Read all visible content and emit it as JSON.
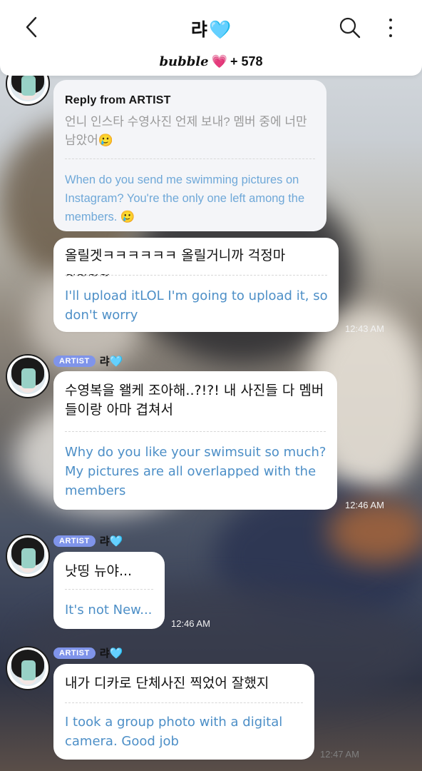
{
  "header": {
    "title": "랴",
    "title_heart": "🩵",
    "brand": "bubble",
    "brand_heart": "💗",
    "count": "+ 578"
  },
  "reply": {
    "heading": "Reply from ARTIST",
    "korean": "언니 인스타 수영사진 언제 보내? 멤버 중에 너만 남았어🥲",
    "english": "When do you send me swimming pictures on Instagram? You're the only one left among the members. 🥲"
  },
  "messages": [
    {
      "korean": "올릴겟ㅋㅋㅋㅋㅋㅋ 올릴거니까 걱정마~~~~",
      "english": "I'll upload itLOL I'm going to upload it, so don't worry",
      "time": "12:43 AM"
    },
    {
      "artist_badge": "ARTIST",
      "artist_name": "랴",
      "artist_heart": "🩵",
      "korean": "수영복을 왤케 조아해..?!?! 내 사진들 다 멤버들이랑 아마 겹쳐서",
      "english": "Why do you like your swimsuit so much? My pictures are all overlapped with the members",
      "time": "12:46 AM"
    },
    {
      "artist_badge": "ARTIST",
      "artist_name": "랴",
      "artist_heart": "🩵",
      "korean": "낫띵 뉴야...",
      "english": "It's not New...",
      "time": "12:46 AM"
    },
    {
      "artist_badge": "ARTIST",
      "artist_name": "랴",
      "artist_heart": "🩵",
      "korean": "내가 디카로 단체사진 찍었어 잘했지",
      "english": "I took a group photo with a digital camera. Good job",
      "time": "12:47 AM"
    }
  ],
  "icons": {
    "back": "chevron-left-icon",
    "search": "search-icon",
    "more": "more-vertical-icon"
  },
  "colors": {
    "accent_blue": "#4d8fc7",
    "badge": "#7f94ea",
    "heart_blue": "#7fc6f0",
    "heart_pink": "#e86bb0"
  }
}
